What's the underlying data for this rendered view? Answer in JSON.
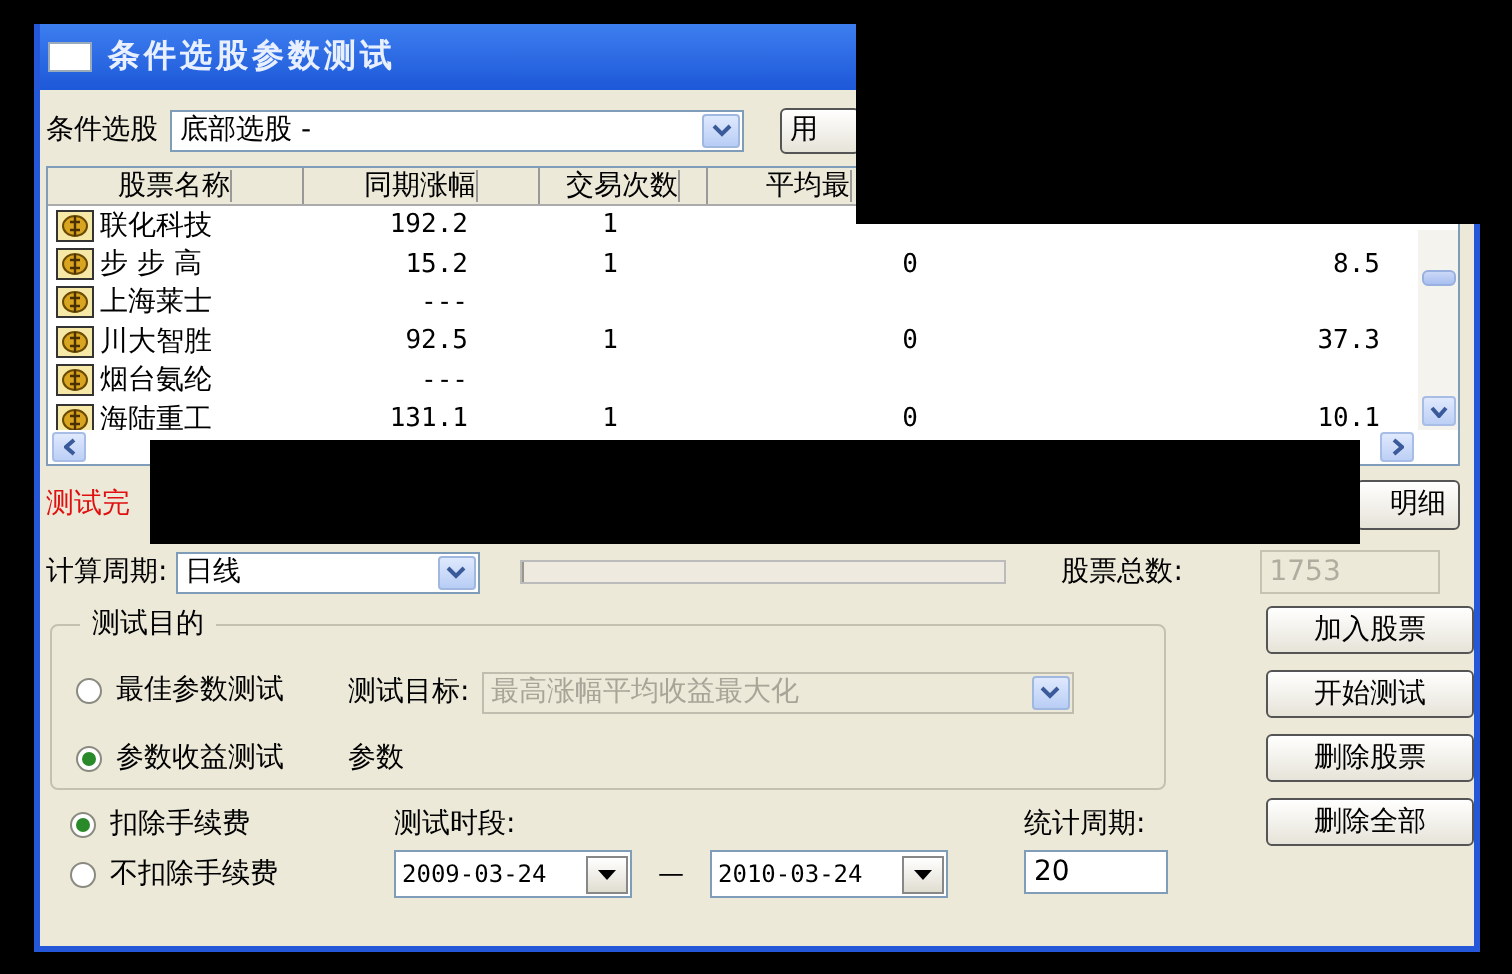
{
  "window": {
    "title": "条件选股参数测试"
  },
  "selector": {
    "label": "条件选股",
    "value": "底部选股  -",
    "apply_button": "用"
  },
  "table": {
    "columns": [
      "股票名称",
      "同期涨幅",
      "交易次数",
      "平均最"
    ],
    "rows": [
      {
        "cells": [
          "联化科技",
          "192.2",
          "1"
        ]
      },
      {
        "cells": [
          "步 步 高",
          "15.2",
          "1",
          "0",
          "8.5"
        ]
      },
      {
        "cells": [
          "上海莱士",
          "---"
        ]
      },
      {
        "cells": [
          "川大智胜",
          "92.5",
          "1",
          "0",
          "37.3"
        ]
      },
      {
        "cells": [
          "烟台氨纶",
          "---"
        ]
      },
      {
        "cells": [
          "海陆重工",
          "131.1",
          "1",
          "0",
          "10.1"
        ]
      }
    ]
  },
  "status": "测试完",
  "detail_button": "明细",
  "period": {
    "label": "计算周期:",
    "value": "日线"
  },
  "progress": {
    "level": 0
  },
  "stock_total": {
    "label": "股票总数:",
    "value": "1753",
    "disabled": true
  },
  "test_goal": {
    "title": "测试目的",
    "options": [
      {
        "label": "最佳参数测试",
        "selected": false
      },
      {
        "label": "参数收益测试",
        "selected": true
      }
    ],
    "target_label": "测试目标:",
    "target_value": "最高涨幅平均收益最大化",
    "target_disabled": true,
    "param_label": "参数"
  },
  "fees": [
    {
      "label": "扣除手续费",
      "selected": true
    },
    {
      "label": "不扣除手续费",
      "selected": false
    }
  ],
  "test_range": {
    "label": "测试时段:",
    "from": "2009-03-24",
    "separator": "—",
    "to": "2010-03-24"
  },
  "stat_period": {
    "label": "统计周期:",
    "value": "20"
  },
  "buttons": [
    "加入股票",
    "开始测试",
    "删除股票",
    "删除全部"
  ]
}
